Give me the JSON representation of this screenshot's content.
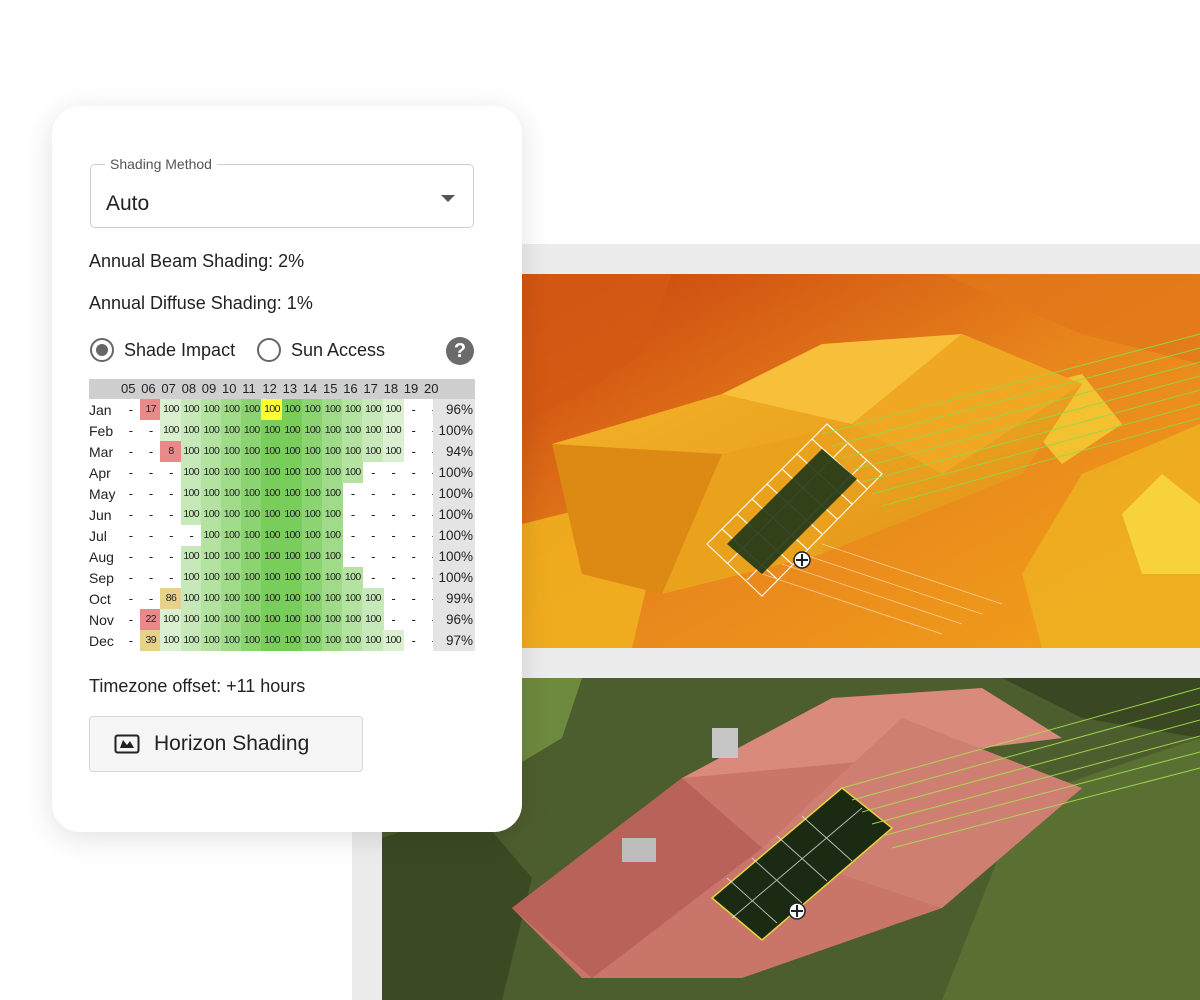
{
  "shading_method": {
    "label": "Shading Method",
    "value": "Auto"
  },
  "annual_beam_shading": "Annual Beam Shading: 2%",
  "annual_diffuse_shading": "Annual Diffuse Shading: 1%",
  "view_mode": {
    "options": [
      "Shade Impact",
      "Sun Access"
    ],
    "selected": "Shade Impact"
  },
  "help_icon": "question-mark-icon",
  "table": {
    "hours": [
      "05",
      "06",
      "07",
      "08",
      "09",
      "10",
      "11",
      "12",
      "13",
      "14",
      "15",
      "16",
      "17",
      "18",
      "19",
      "20"
    ],
    "rows": [
      {
        "month": "Jan",
        "cells": [
          "-",
          "17",
          "100",
          "100",
          "100",
          "100",
          "100",
          "100",
          "100",
          "100",
          "100",
          "100",
          "100",
          "100",
          "-",
          "-"
        ],
        "total": "96%"
      },
      {
        "month": "Feb",
        "cells": [
          "-",
          "-",
          "100",
          "100",
          "100",
          "100",
          "100",
          "100",
          "100",
          "100",
          "100",
          "100",
          "100",
          "100",
          "-",
          "-"
        ],
        "total": "100%"
      },
      {
        "month": "Mar",
        "cells": [
          "-",
          "-",
          "8",
          "100",
          "100",
          "100",
          "100",
          "100",
          "100",
          "100",
          "100",
          "100",
          "100",
          "100",
          "-",
          "-"
        ],
        "total": "94%"
      },
      {
        "month": "Apr",
        "cells": [
          "-",
          "-",
          "-",
          "100",
          "100",
          "100",
          "100",
          "100",
          "100",
          "100",
          "100",
          "100",
          "-",
          "-",
          "-",
          "-"
        ],
        "total": "100%"
      },
      {
        "month": "May",
        "cells": [
          "-",
          "-",
          "-",
          "100",
          "100",
          "100",
          "100",
          "100",
          "100",
          "100",
          "100",
          "-",
          "-",
          "-",
          "-",
          "-"
        ],
        "total": "100%"
      },
      {
        "month": "Jun",
        "cells": [
          "-",
          "-",
          "-",
          "100",
          "100",
          "100",
          "100",
          "100",
          "100",
          "100",
          "100",
          "-",
          "-",
          "-",
          "-",
          "-"
        ],
        "total": "100%"
      },
      {
        "month": "Jul",
        "cells": [
          "-",
          "-",
          "-",
          "-",
          "100",
          "100",
          "100",
          "100",
          "100",
          "100",
          "100",
          "-",
          "-",
          "-",
          "-",
          "-"
        ],
        "total": "100%"
      },
      {
        "month": "Aug",
        "cells": [
          "-",
          "-",
          "-",
          "100",
          "100",
          "100",
          "100",
          "100",
          "100",
          "100",
          "100",
          "-",
          "-",
          "-",
          "-",
          "-"
        ],
        "total": "100%"
      },
      {
        "month": "Sep",
        "cells": [
          "-",
          "-",
          "-",
          "100",
          "100",
          "100",
          "100",
          "100",
          "100",
          "100",
          "100",
          "100",
          "-",
          "-",
          "-",
          "-"
        ],
        "total": "100%"
      },
      {
        "month": "Oct",
        "cells": [
          "-",
          "-",
          "86",
          "100",
          "100",
          "100",
          "100",
          "100",
          "100",
          "100",
          "100",
          "100",
          "100",
          "-",
          "-",
          "-"
        ],
        "total": "99%"
      },
      {
        "month": "Nov",
        "cells": [
          "-",
          "22",
          "100",
          "100",
          "100",
          "100",
          "100",
          "100",
          "100",
          "100",
          "100",
          "100",
          "100",
          "-",
          "-",
          "-"
        ],
        "total": "96%"
      },
      {
        "month": "Dec",
        "cells": [
          "-",
          "39",
          "100",
          "100",
          "100",
          "100",
          "100",
          "100",
          "100",
          "100",
          "100",
          "100",
          "100",
          "100",
          "-",
          "-"
        ],
        "total": "97%"
      }
    ]
  },
  "timezone_offset": "Timezone offset: +11 hours",
  "horizon_button": {
    "label": "Horizon Shading",
    "icon": "panorama-horizon-icon"
  },
  "colors": {
    "low": "#e88a8a",
    "mid": "#e6d28a",
    "highlight": "#ffff33",
    "green_strong": "#6fc94f",
    "green_light": "#d8f0cc"
  }
}
